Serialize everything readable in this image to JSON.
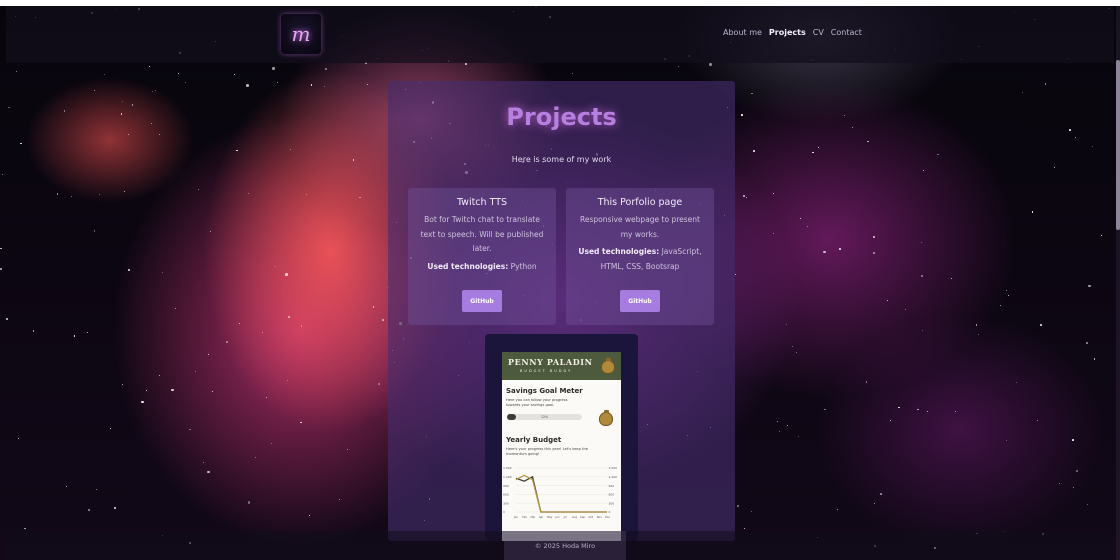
{
  "navbar": {
    "logo_glyph": "m",
    "links": [
      {
        "label": "About me",
        "active": false
      },
      {
        "label": "Projects",
        "active": true
      },
      {
        "label": "CV",
        "active": false
      },
      {
        "label": "Contact",
        "active": false
      }
    ]
  },
  "main": {
    "title": "Projects",
    "subtitle": "Here is some of my work",
    "projects": [
      {
        "title": "Twitch TTS",
        "description": "Bot for Twitch chat to translate text to speech. Will be published later.",
        "tech_label": "Used technologies:",
        "tech": "Python",
        "button": "GitHub"
      },
      {
        "title": "This Porfolio page",
        "description": "Responsive webpage to present my works.",
        "tech_label": "Used technologies:",
        "tech": "JavaScript, HTML, CSS, Bootsrap",
        "button": "GitHub"
      }
    ],
    "preview": {
      "app_title": "PENNY PALADIN",
      "app_subtitle": "BUDGET BUDDY",
      "savings_heading": "Savings Goal Meter",
      "savings_text": "Here you can follow your progress towards your savings goal.",
      "savings_progress": 0.12,
      "savings_progress_label": "12%",
      "yearly_heading": "Yearly Budget",
      "yearly_text": "Here's your progress this year! Let's keep the momentum going!",
      "chart_y_ticks": [
        "1,500",
        "1,200",
        "900",
        "600",
        "300",
        "0"
      ],
      "chart_months": [
        "Jan",
        "Feb",
        "Mar",
        "Apr",
        "May",
        "Jun",
        "Jul",
        "Aug",
        "Sep",
        "Oct",
        "Nov",
        "Dec"
      ],
      "series_dark": [
        1150,
        1050,
        1200,
        0,
        0,
        0,
        0,
        0,
        0,
        0,
        0,
        0
      ],
      "series_gold": [
        1100,
        1250,
        1100,
        0,
        0,
        0,
        0,
        0,
        0,
        0,
        0,
        0
      ],
      "y_max": 1500,
      "color_dark": "#3a3a3a",
      "color_gold": "#b8953f"
    }
  },
  "footer": {
    "text": "© 2025 Hoda Miro"
  },
  "colors": {
    "accent": "#a77ce0",
    "title_glow": "#b77fe0",
    "app_green": "#4d5a3e"
  }
}
